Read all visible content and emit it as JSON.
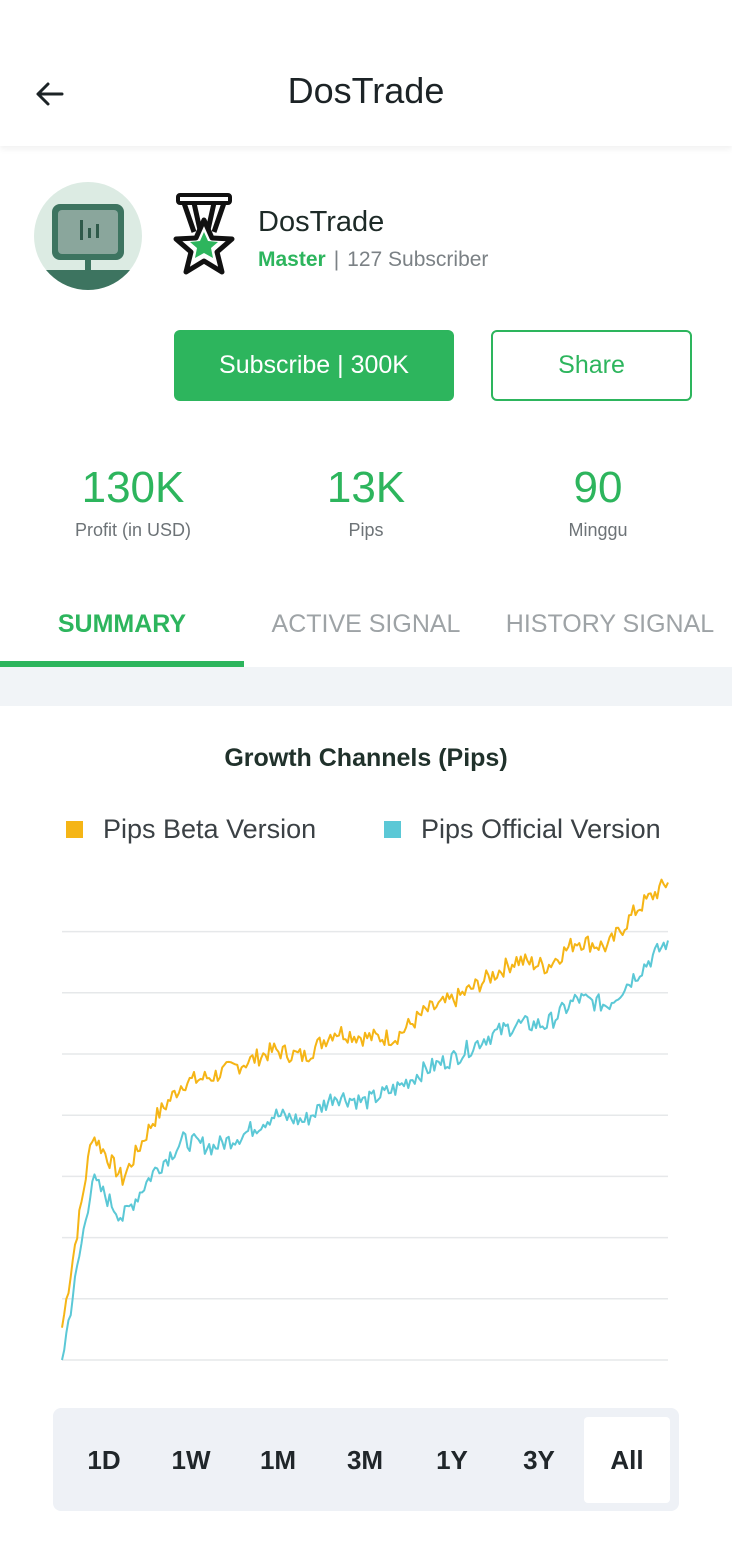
{
  "header": {
    "title": "DosTrade"
  },
  "profile": {
    "name": "DosTrade",
    "level": "Master",
    "separator": "|",
    "subscribers": "127 Subscriber",
    "subscribe_label": "Subscribe | 300K",
    "share_label": "Share"
  },
  "stats": [
    {
      "value": "130K",
      "label": "Profit (in USD)"
    },
    {
      "value": "13K",
      "label": "Pips"
    },
    {
      "value": "90",
      "label": "Minggu"
    }
  ],
  "tabs": [
    {
      "label": "SUMMARY",
      "active": true
    },
    {
      "label": "ACTIVE SIGNAL",
      "active": false
    },
    {
      "label": "HISTORY SIGNAL",
      "active": false
    }
  ],
  "ranges": [
    {
      "label": "1D",
      "active": false
    },
    {
      "label": "1W",
      "active": false
    },
    {
      "label": "1M",
      "active": false
    },
    {
      "label": "3M",
      "active": false
    },
    {
      "label": "1Y",
      "active": false
    },
    {
      "label": "3Y",
      "active": false
    },
    {
      "label": "All",
      "active": true
    }
  ],
  "colors": {
    "accent": "#2db55d",
    "beta": "#f5b516",
    "official": "#5bc8d6"
  },
  "chart_data": {
    "type": "line",
    "title": "Growth Channels (Pips)",
    "grid": true,
    "legend": "top",
    "x": [
      0,
      5,
      10,
      15,
      20,
      25,
      30,
      35,
      40,
      45,
      50,
      55,
      60,
      65,
      70,
      75,
      80,
      85,
      90,
      95,
      100
    ],
    "ylim": [
      0,
      7.5
    ],
    "series": [
      {
        "name": "Pips Beta Version",
        "color": "#f5b516",
        "values": [
          0.5,
          3.5,
          2.8,
          3.7,
          4.3,
          4.4,
          4.6,
          4.8,
          4.7,
          5.1,
          5.0,
          5.0,
          5.4,
          5.6,
          5.9,
          6.2,
          6.1,
          6.5,
          6.4,
          7.0,
          7.4
        ]
      },
      {
        "name": "Pips Official Version",
        "color": "#5bc8d6",
        "values": [
          0.0,
          2.8,
          2.2,
          2.9,
          3.4,
          3.3,
          3.5,
          3.8,
          3.7,
          4.1,
          4.0,
          4.2,
          4.5,
          4.7,
          5.0,
          5.2,
          5.2,
          5.6,
          5.5,
          6.0,
          6.5
        ]
      }
    ]
  }
}
